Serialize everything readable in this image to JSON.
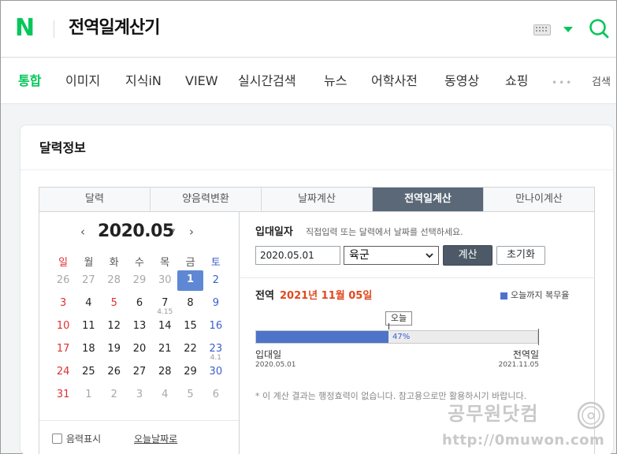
{
  "header": {
    "logo_text": "N",
    "query": "전역일계산기"
  },
  "nav": {
    "items": [
      "통합",
      "이미지",
      "지식iN",
      "VIEW",
      "실시간검색",
      "뉴스",
      "어학사전",
      "동영상",
      "쇼핑"
    ],
    "active_index": 0,
    "more_label": "•••",
    "trailing_label": "검색"
  },
  "card": {
    "title": "달력정보",
    "tabs": [
      "달력",
      "양음력변환",
      "날짜계산",
      "전역일계산",
      "만나이계산"
    ],
    "active_tab_index": 3
  },
  "calendar": {
    "prev_arrow": "‹",
    "next_arrow": "›",
    "month": "2020.05",
    "dropdown_caret": "▾",
    "weekdays": [
      "일",
      "월",
      "화",
      "수",
      "목",
      "금",
      "토"
    ],
    "weeks": [
      [
        {
          "d": "26",
          "o": true
        },
        {
          "d": "27",
          "o": true
        },
        {
          "d": "28",
          "o": true
        },
        {
          "d": "29",
          "o": true
        },
        {
          "d": "30",
          "o": true
        },
        {
          "d": "1",
          "sel": true
        },
        {
          "d": "2"
        }
      ],
      [
        {
          "d": "3"
        },
        {
          "d": "4"
        },
        {
          "d": "5",
          "red": true
        },
        {
          "d": "6"
        },
        {
          "d": "7",
          "lunar": "4.15"
        },
        {
          "d": "8"
        },
        {
          "d": "9"
        }
      ],
      [
        {
          "d": "10"
        },
        {
          "d": "11"
        },
        {
          "d": "12"
        },
        {
          "d": "13"
        },
        {
          "d": "14"
        },
        {
          "d": "15"
        },
        {
          "d": "16"
        }
      ],
      [
        {
          "d": "17"
        },
        {
          "d": "18"
        },
        {
          "d": "19"
        },
        {
          "d": "20"
        },
        {
          "d": "21"
        },
        {
          "d": "22"
        },
        {
          "d": "23",
          "lunar": "4.1"
        }
      ],
      [
        {
          "d": "24"
        },
        {
          "d": "25"
        },
        {
          "d": "26"
        },
        {
          "d": "27"
        },
        {
          "d": "28"
        },
        {
          "d": "29"
        },
        {
          "d": "30"
        }
      ],
      [
        {
          "d": "31"
        },
        {
          "d": "1",
          "o": true
        },
        {
          "d": "2",
          "o": true
        },
        {
          "d": "3",
          "o": true
        },
        {
          "d": "4",
          "o": true
        },
        {
          "d": "5",
          "o": true
        },
        {
          "d": "6",
          "o": true
        }
      ]
    ],
    "lunar_checkbox_label": "음력표시",
    "today_link": "오늘날짜로"
  },
  "calc": {
    "enlist_label": "입대일자",
    "hint": "직접입력 또는 달력에서 날짜를 선택하세요.",
    "date_value": "2020.05.01",
    "branch_value": "육군",
    "calc_button": "계산",
    "reset_button": "초기화",
    "result_label": "전역",
    "result_date": "2021년 11월 05일",
    "legend_label": "오늘까지 복무율",
    "today_tag": "오늘",
    "progress_percent": 47,
    "progress_label": "47%",
    "start_label": "입대일",
    "start_date": "2020.05.01",
    "end_label": "전역일",
    "end_date": "2021.11.05",
    "notice": "* 이 계산 결과는 행정효력이 없습니다. 참고용으로만 활용하시기 바랍니다."
  },
  "watermark": {
    "text": "공무원닷컴",
    "url": "http://0muwon.com"
  },
  "colors": {
    "brand_green": "#03c75a",
    "tab_active": "#5a6877",
    "selected_day": "#5e88d4",
    "progress_fill": "#4d74c8",
    "result_date": "#e0491d"
  }
}
